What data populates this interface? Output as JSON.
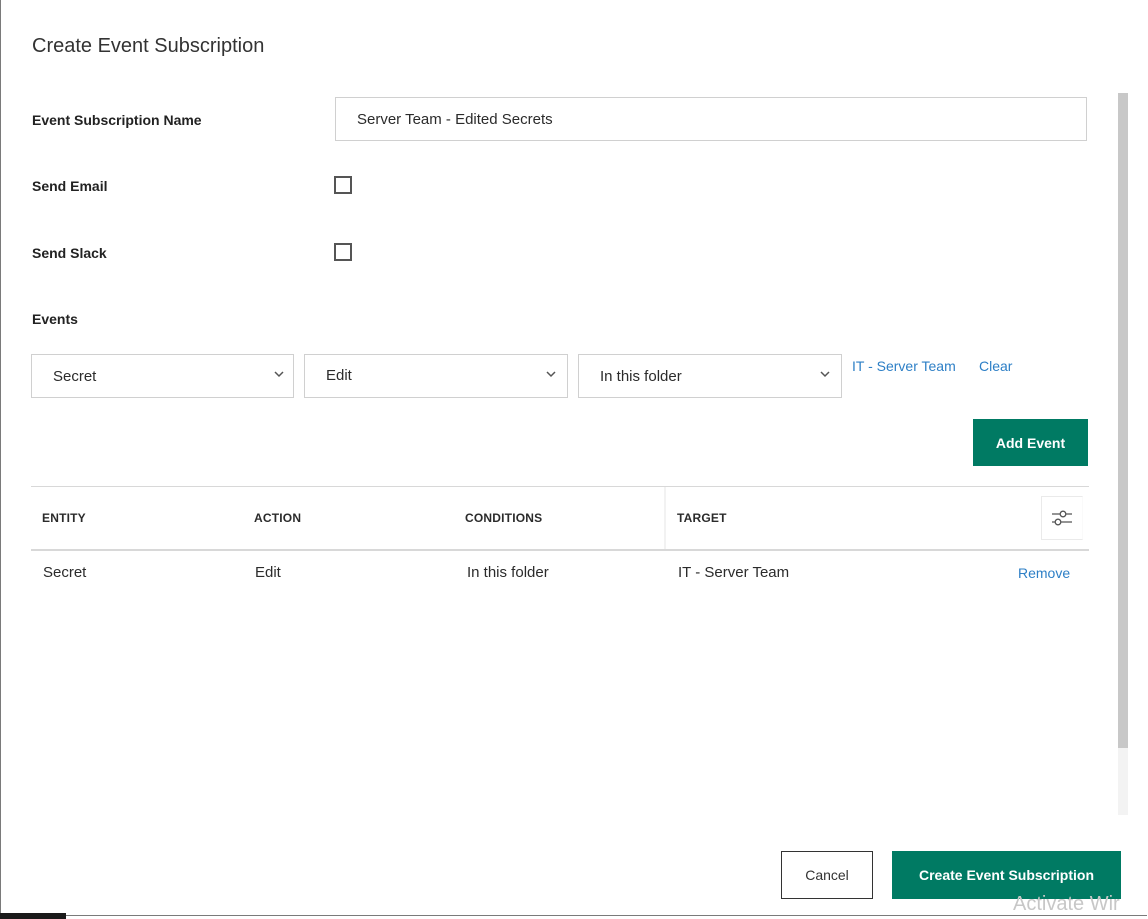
{
  "dialog": {
    "title": "Create Event Subscription"
  },
  "form": {
    "name_label": "Event Subscription Name",
    "name_value": "Server Team - Edited Secrets",
    "send_email_label": "Send Email",
    "send_email_checked": false,
    "send_slack_label": "Send Slack",
    "send_slack_checked": false,
    "events_label": "Events"
  },
  "event_builder": {
    "entity_select": "Secret",
    "action_select": "Edit",
    "condition_select": "In this folder",
    "target_link": "IT - Server Team",
    "clear_link": "Clear",
    "add_event_button": "Add Event"
  },
  "table": {
    "headers": [
      "ENTITY",
      "ACTION",
      "CONDITIONS",
      "TARGET"
    ],
    "rows": [
      {
        "entity": "Secret",
        "action": "Edit",
        "conditions": "In this folder",
        "target": "IT - Server Team",
        "remove_label": "Remove"
      }
    ],
    "settings_icon": "sliders-icon"
  },
  "footer": {
    "cancel_button": "Cancel",
    "create_button": "Create Event Subscription"
  },
  "watermark": "Activate Wir",
  "colors": {
    "primary": "#007a63",
    "link": "#2d7fc6"
  }
}
